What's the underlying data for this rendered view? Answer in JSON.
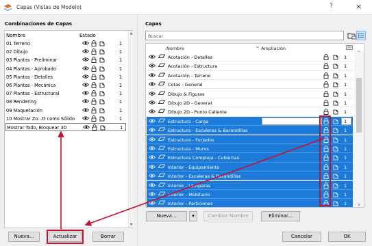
{
  "window": {
    "title": "Capas (Vistas de Modelo)",
    "help": "?",
    "close": "×"
  },
  "left": {
    "section_title": "Combinaciones de Capas",
    "columns": {
      "name": "Nombre",
      "state": "Estado"
    },
    "rows": [
      {
        "name": "01 Terreno",
        "num": "1"
      },
      {
        "name": "02 Dibujo",
        "num": "1"
      },
      {
        "name": "03 Plantas - Preliminar",
        "num": "1"
      },
      {
        "name": "04 Plantas - Aprobado",
        "num": "1"
      },
      {
        "name": "05 Plantas - Detalles",
        "num": "1"
      },
      {
        "name": "06 Plantas - Mecánica",
        "num": "1"
      },
      {
        "name": "07 Plantas - Estructural",
        "num": "1"
      },
      {
        "name": "08 Rendering",
        "num": "1"
      },
      {
        "name": "09 Maquetación",
        "num": "1"
      },
      {
        "name": "10 Mostrar Zo...D como Sólido",
        "num": "1"
      },
      {
        "name": "Mostrar Todo, Bloquear 3D",
        "num": "1"
      }
    ],
    "buttons": {
      "new": "Nueva...",
      "update": "Actualizar",
      "delete": "Borrar"
    }
  },
  "right": {
    "section_title": "Capas",
    "search_placeholder": "Buscar",
    "columns": {
      "name": "Nombre",
      "ampl": "Ampliación"
    },
    "rows": [
      {
        "name": "Acotación - Detalles",
        "num": "1",
        "selected": false
      },
      {
        "name": "Acotación - Estructura",
        "num": "1",
        "selected": false
      },
      {
        "name": "Acotación - Terreno",
        "num": "1",
        "selected": false
      },
      {
        "name": "Cotas - General",
        "num": "1",
        "selected": false
      },
      {
        "name": "Dibujo & Figuras",
        "num": "1",
        "selected": false
      },
      {
        "name": "Dibujo 2D - General",
        "num": "1",
        "selected": false
      },
      {
        "name": "Dibujo 2D - Punto Caliente",
        "num": "1",
        "selected": false
      },
      {
        "name": "Estructura - Carga",
        "num": "1",
        "selected": true
      },
      {
        "name": "Estructura - Escaleras & Barandillas",
        "num": "1",
        "selected": true
      },
      {
        "name": "Estructura - Forjados",
        "num": "1",
        "selected": true
      },
      {
        "name": "Estructura - Muros",
        "num": "1",
        "selected": true
      },
      {
        "name": "Estructura Compleja - Cubiertas",
        "num": "1",
        "selected": true
      },
      {
        "name": "Interior - Equipamiento",
        "num": "1",
        "selected": true
      },
      {
        "name": "Interior - Escaleras & Barandillas",
        "num": "1",
        "selected": true
      },
      {
        "name": "Interior - Lámparas",
        "num": "1",
        "selected": true
      },
      {
        "name": "Interior - Mobiliario",
        "num": "1",
        "selected": true
      },
      {
        "name": "Interior - Particiones",
        "num": "1",
        "selected": true
      }
    ],
    "buttons": {
      "new": "Nueva...",
      "rename": "Cambiar Nombre",
      "delete": "Eliminar..."
    }
  },
  "footer": {
    "cancel": "Cancelar",
    "ok": "OK"
  },
  "colors": {
    "selection": "#1c7bd9",
    "annotation": "#c8102e"
  }
}
